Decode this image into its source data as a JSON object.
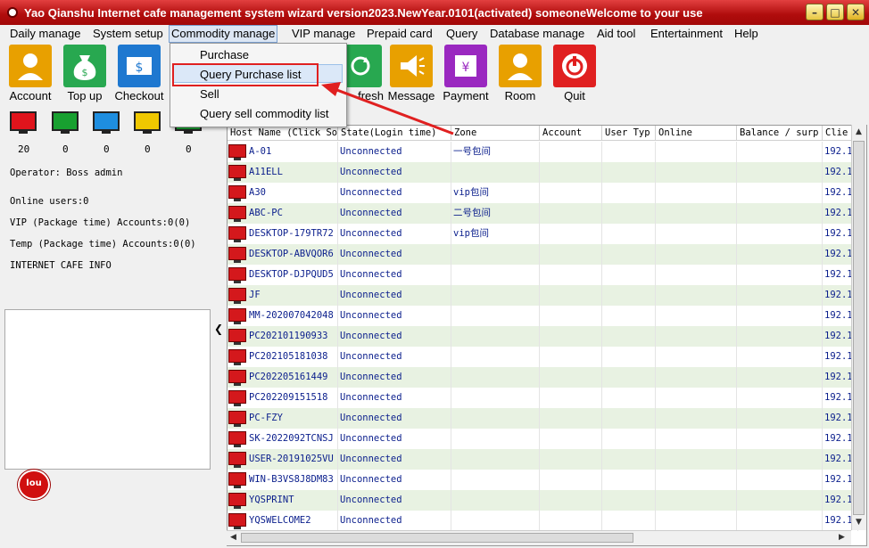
{
  "window": {
    "title": "Yao Qianshu Internet cafe management system wizard version2023.NewYear.0101(activated)  someoneWelcome to your use",
    "minimize": "–",
    "maximize": "□",
    "close": "✕"
  },
  "menubar": {
    "items": [
      "Daily manage",
      "System setup",
      "Commodity manage",
      "VIP manage",
      "Prepaid card",
      "Query",
      "Database manage",
      "Aid tool",
      "Entertainment",
      "Help"
    ],
    "active": "Commodity manage"
  },
  "dropdown": {
    "items": [
      "Purchase",
      "Query Purchase list",
      "Sell",
      "Query sell commodity list"
    ],
    "highlighted": "Query Purchase list"
  },
  "toolbar": {
    "buttons": [
      {
        "label": "Account",
        "icon": "user-icon",
        "color": "#e8a000"
      },
      {
        "label": "Top up",
        "icon": "money-bag-icon",
        "color": "#28a850"
      },
      {
        "label": "Checkout",
        "icon": "dollar-icon",
        "color": "#1e78d0"
      },
      {
        "label": "fresh",
        "icon": "refresh-icon",
        "color": "#28a850"
      },
      {
        "label": "Message",
        "icon": "megaphone-icon",
        "color": "#e8a000"
      },
      {
        "label": "Payment",
        "icon": "yen-icon",
        "color": "#9a28c0"
      },
      {
        "label": "Room",
        "icon": "user-icon",
        "color": "#e8a000"
      },
      {
        "label": "Quit",
        "icon": "power-icon",
        "color": "#e02020"
      }
    ]
  },
  "status_monitors": [
    {
      "color": "#e0141c",
      "count": "20"
    },
    {
      "color": "#18a030",
      "count": "0"
    },
    {
      "color": "#1e8ee0",
      "count": "0"
    },
    {
      "color": "#f0c800",
      "count": "0"
    },
    {
      "color": "#18a030",
      "count": "0"
    }
  ],
  "left_panel": {
    "operator": "Operator: Boss admin",
    "online_users": "Online users:0",
    "vip": "VIP (Package time) Accounts:0(0)",
    "temp": "Temp (Package time) Accounts:0(0)",
    "cafe_info": "INTERNET CAFE  INFO",
    "badge_text": "lou"
  },
  "grid": {
    "columns": [
      "Host Name (Click So",
      "State(Login time)",
      "Zone",
      "Account",
      "User Typ",
      "Online",
      "Balance / surp",
      "Clie"
    ],
    "rows": [
      {
        "host": "A-01",
        "state": "Unconnected",
        "zone": "一号包间",
        "client": "192.1"
      },
      {
        "host": "A11ELL",
        "state": "Unconnected",
        "zone": "",
        "client": "192.1"
      },
      {
        "host": "A30",
        "state": "Unconnected",
        "zone": "vip包间",
        "client": "192.1"
      },
      {
        "host": "ABC-PC",
        "state": "Unconnected",
        "zone": "二号包间",
        "client": "192.1"
      },
      {
        "host": "DESKTOP-179TR72",
        "state": "Unconnected",
        "zone": "vip包间",
        "client": "192.1"
      },
      {
        "host": "DESKTOP-ABVQOR6",
        "state": "Unconnected",
        "zone": "",
        "client": "192.1"
      },
      {
        "host": "DESKTOP-DJPQUD5",
        "state": "Unconnected",
        "zone": "",
        "client": "192.1"
      },
      {
        "host": "JF",
        "state": "Unconnected",
        "zone": "",
        "client": "192.1"
      },
      {
        "host": "MM-202007042048",
        "state": "Unconnected",
        "zone": "",
        "client": "192.1"
      },
      {
        "host": "PC202101190933",
        "state": "Unconnected",
        "zone": "",
        "client": "192.1"
      },
      {
        "host": "PC202105181038",
        "state": "Unconnected",
        "zone": "",
        "client": "192.1"
      },
      {
        "host": "PC202205161449",
        "state": "Unconnected",
        "zone": "",
        "client": "192.1"
      },
      {
        "host": "PC202209151518",
        "state": "Unconnected",
        "zone": "",
        "client": "192.1"
      },
      {
        "host": "PC-FZY",
        "state": "Unconnected",
        "zone": "",
        "client": "192.1"
      },
      {
        "host": "SK-2022092TCNSJ",
        "state": "Unconnected",
        "zone": "",
        "client": "192.1"
      },
      {
        "host": "USER-20191025VU",
        "state": "Unconnected",
        "zone": "",
        "client": "192.1"
      },
      {
        "host": "WIN-B3VS8J8DM83",
        "state": "Unconnected",
        "zone": "",
        "client": "192.1"
      },
      {
        "host": "YQSPRINT",
        "state": "Unconnected",
        "zone": "",
        "client": "192.1"
      },
      {
        "host": "YQSWELCOME2",
        "state": "Unconnected",
        "zone": "",
        "client": "192.1"
      }
    ]
  },
  "colors": {
    "titlebar": "#b00c0c",
    "row_alt": "#e8f2e2",
    "cell_text": "#0a1e8c",
    "annotation": "#e02020"
  }
}
